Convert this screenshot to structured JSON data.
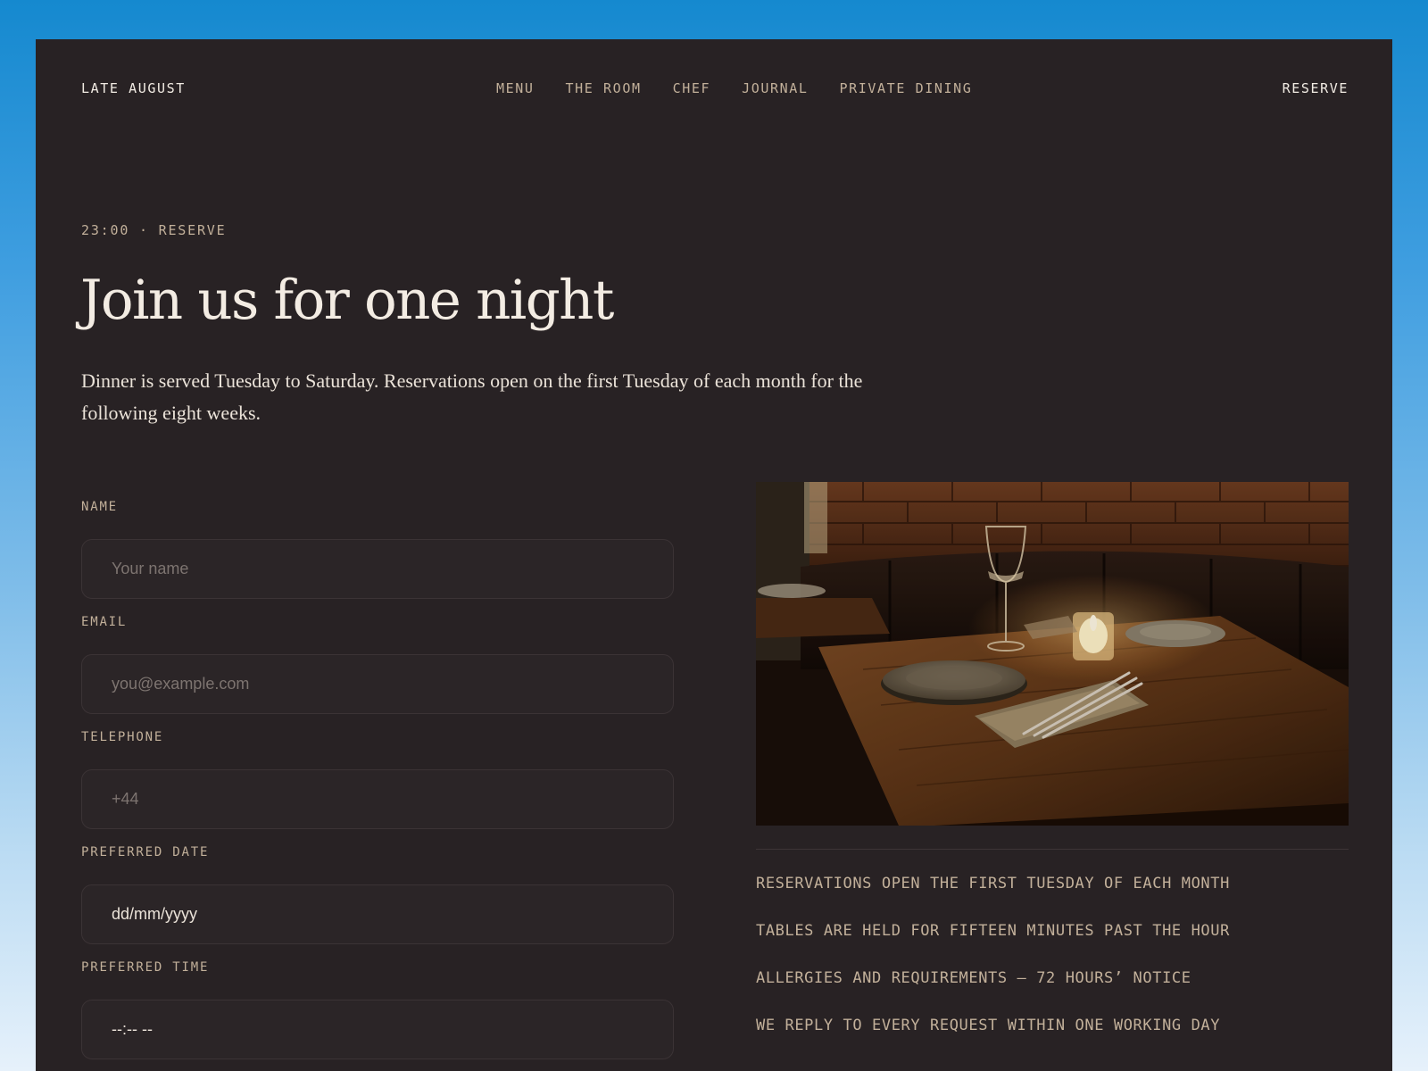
{
  "nav": {
    "brand": "LATE AUGUST",
    "links": [
      "MENU",
      "THE ROOM",
      "CHEF",
      "JOURNAL",
      "PRIVATE DINING"
    ],
    "cta": "RESERVE"
  },
  "hero": {
    "eyebrow": "23:00 · RESERVE",
    "title": "Join us for one night",
    "intro": "Dinner is served Tuesday to Saturday. Reservations open on the first Tuesday of each month for the following eight weeks."
  },
  "form": {
    "name": {
      "label": "NAME",
      "placeholder": "Your name"
    },
    "email": {
      "label": "EMAIL",
      "placeholder": "you@example.com"
    },
    "telephone": {
      "label": "TELEPHONE",
      "placeholder": "+44"
    },
    "date": {
      "label": "PREFERRED DATE",
      "placeholder": "dd/mm/yyyy"
    },
    "time": {
      "label": "PREFERRED TIME",
      "placeholder": "--:-- --"
    }
  },
  "notes": [
    "RESERVATIONS OPEN THE FIRST TUESDAY OF EACH MONTH",
    "TABLES ARE HELD FOR FIFTEEN MINUTES PAST THE HOUR",
    "ALLERGIES AND REQUIREMENTS — 72 HOURS’ NOTICE",
    "WE REPLY TO EVERY REQUEST WITHIN ONE WORKING DAY"
  ],
  "colors": {
    "page_background": "#1589cf",
    "panel": "#282224",
    "text_primary": "#f3ece3",
    "text_muted": "#c2b09a",
    "field_border": "#3b3335"
  }
}
